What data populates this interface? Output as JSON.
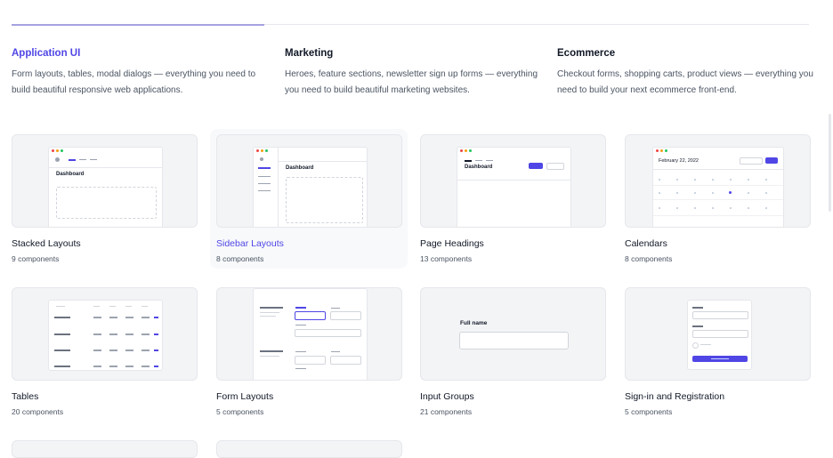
{
  "categories": [
    {
      "title": "Application UI",
      "description": "Form layouts, tables, modal dialogs — everything you need to build beautiful responsive web applications."
    },
    {
      "title": "Marketing",
      "description": "Heroes, feature sections, newsletter sign up forms — everything you need to build beautiful marketing websites."
    },
    {
      "title": "Ecommerce",
      "description": "Checkout forms, shopping carts, product views — everything you need to build your next ecommerce front-end."
    }
  ],
  "cards": [
    {
      "title": "Stacked Layouts",
      "count": "9 components",
      "preview_text": "Dashboard"
    },
    {
      "title": "Sidebar Layouts",
      "count": "8 components",
      "preview_text": "Dashboard"
    },
    {
      "title": "Page Headings",
      "count": "13 components",
      "preview_text": "Dashboard"
    },
    {
      "title": "Calendars",
      "count": "8 components",
      "preview_text": "February 22, 2022"
    },
    {
      "title": "Tables",
      "count": "20 components"
    },
    {
      "title": "Form Layouts",
      "count": "5 components"
    },
    {
      "title": "Input Groups",
      "count": "21 components",
      "preview_text": "Full name"
    },
    {
      "title": "Sign-in and Registration",
      "count": "5 components"
    }
  ],
  "colors": {
    "accent": "#4f46e5",
    "text": "#111827",
    "muted": "#4b5563",
    "card_bg": "#f3f4f6"
  }
}
